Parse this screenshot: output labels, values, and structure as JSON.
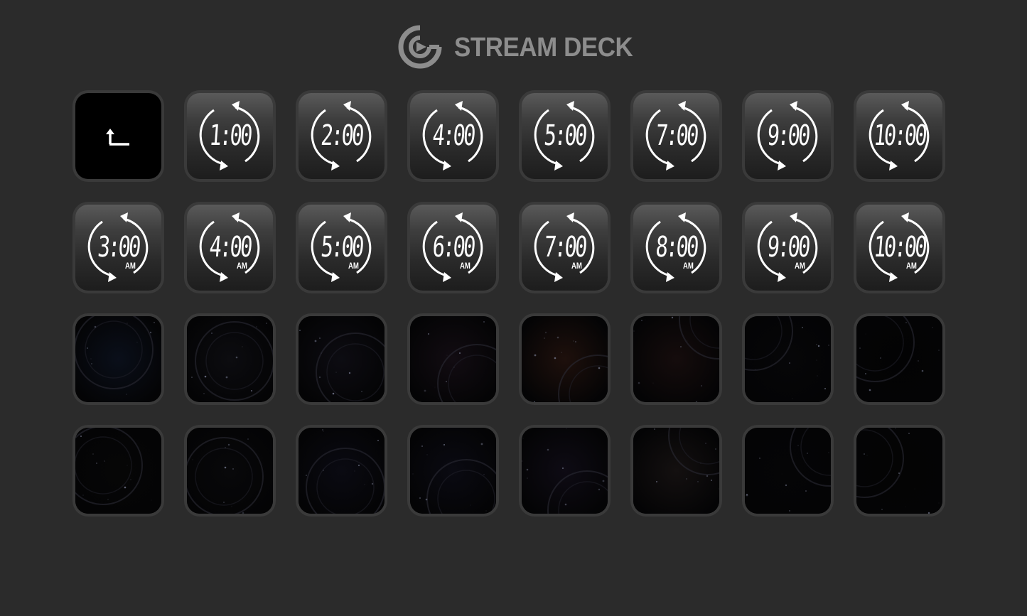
{
  "app": {
    "brand_title": "STREAM DECK"
  },
  "colors": {
    "background": "#2b2b2b",
    "key_border": "#3a3a3a",
    "brand_gray": "#8d8d8d",
    "clock_text": "#ffffff"
  },
  "keys": {
    "row1": [
      {
        "type": "back",
        "icon": "back-arrow-icon"
      },
      {
        "type": "clock",
        "time": "1:00",
        "suffix": ""
      },
      {
        "type": "clock",
        "time": "2:00",
        "suffix": ""
      },
      {
        "type": "clock",
        "time": "4:00",
        "suffix": ""
      },
      {
        "type": "clock",
        "time": "5:00",
        "suffix": ""
      },
      {
        "type": "clock",
        "time": "7:00",
        "suffix": ""
      },
      {
        "type": "clock",
        "time": "9:00",
        "suffix": ""
      },
      {
        "type": "clock",
        "time": "10:00",
        "suffix": ""
      }
    ],
    "row2": [
      {
        "type": "clock",
        "time": "3:00",
        "suffix": "AM"
      },
      {
        "type": "clock",
        "time": "4:00",
        "suffix": "AM"
      },
      {
        "type": "clock",
        "time": "5:00",
        "suffix": "AM"
      },
      {
        "type": "clock",
        "time": "6:00",
        "suffix": "AM"
      },
      {
        "type": "clock",
        "time": "7:00",
        "suffix": "AM"
      },
      {
        "type": "clock",
        "time": "8:00",
        "suffix": "AM"
      },
      {
        "type": "clock",
        "time": "9:00",
        "suffix": "AM"
      },
      {
        "type": "clock",
        "time": "10:00",
        "suffix": "AM"
      }
    ],
    "row3": [
      {
        "type": "background",
        "tint": "#0a0f1a"
      },
      {
        "type": "background",
        "tint": "#0c0c10"
      },
      {
        "type": "background",
        "tint": "#0d0c12"
      },
      {
        "type": "background",
        "tint": "#120c12"
      },
      {
        "type": "background",
        "tint": "#1e100c"
      },
      {
        "type": "background",
        "tint": "#150c0c"
      },
      {
        "type": "background",
        "tint": "#060608"
      },
      {
        "type": "background",
        "tint": "#030304"
      }
    ],
    "row4": [
      {
        "type": "background",
        "tint": "#060606"
      },
      {
        "type": "background",
        "tint": "#08080a"
      },
      {
        "type": "background",
        "tint": "#0a0a12"
      },
      {
        "type": "background",
        "tint": "#0a0a12"
      },
      {
        "type": "background",
        "tint": "#0e0b14"
      },
      {
        "type": "background",
        "tint": "#141010"
      },
      {
        "type": "background",
        "tint": "#050506"
      },
      {
        "type": "background",
        "tint": "#040404"
      }
    ]
  }
}
